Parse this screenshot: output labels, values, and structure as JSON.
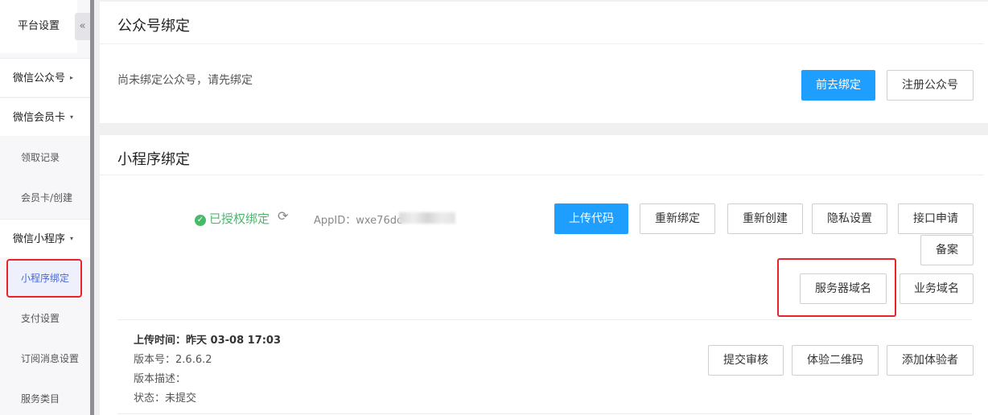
{
  "sidebar": {
    "title": "平台设置",
    "collapse_glyph": "«",
    "groups": {
      "wechat_public": "微信公众号",
      "wechat_card": "微信会员卡",
      "mini_program": "微信小程序"
    },
    "items": {
      "receive_records": "领取记录",
      "card_create": "会员卡/创建",
      "mini_bind": "小程序绑定",
      "payment_settings": "支付设置",
      "subscribe_msg": "订阅消息设置",
      "service_category": "服务类目"
    }
  },
  "public_account": {
    "title": "公众号绑定",
    "message": "尚未绑定公众号，请先绑定",
    "bind_button": "前去绑定",
    "register_button": "注册公众号"
  },
  "mini_program": {
    "title": "小程序绑定",
    "status": "已授权绑定",
    "appid_label": "AppID：",
    "appid_value": "wxe76dc",
    "buttons": {
      "upload": "上传代码",
      "rebind": "重新绑定",
      "recreate": "重新创建",
      "privacy": "隐私设置",
      "api_apply": "接口申请",
      "filing": "备案",
      "server_domain": "服务器域名",
      "business_domain": "业务域名"
    },
    "version": {
      "upload_time_label": "上传时间：",
      "upload_time": "昨天 03-08 17:03",
      "version_label": "版本号：",
      "version": "2.6.6.2",
      "desc_label": "版本描述：",
      "status_label": "状态：",
      "status": "未提交",
      "submit_button": "提交审核",
      "qr_button": "体验二维码",
      "add_tester_button": "添加体验者"
    }
  },
  "colors": {
    "primary": "#1e9fff",
    "success": "#47bb6a",
    "highlight": "#e8232a"
  }
}
